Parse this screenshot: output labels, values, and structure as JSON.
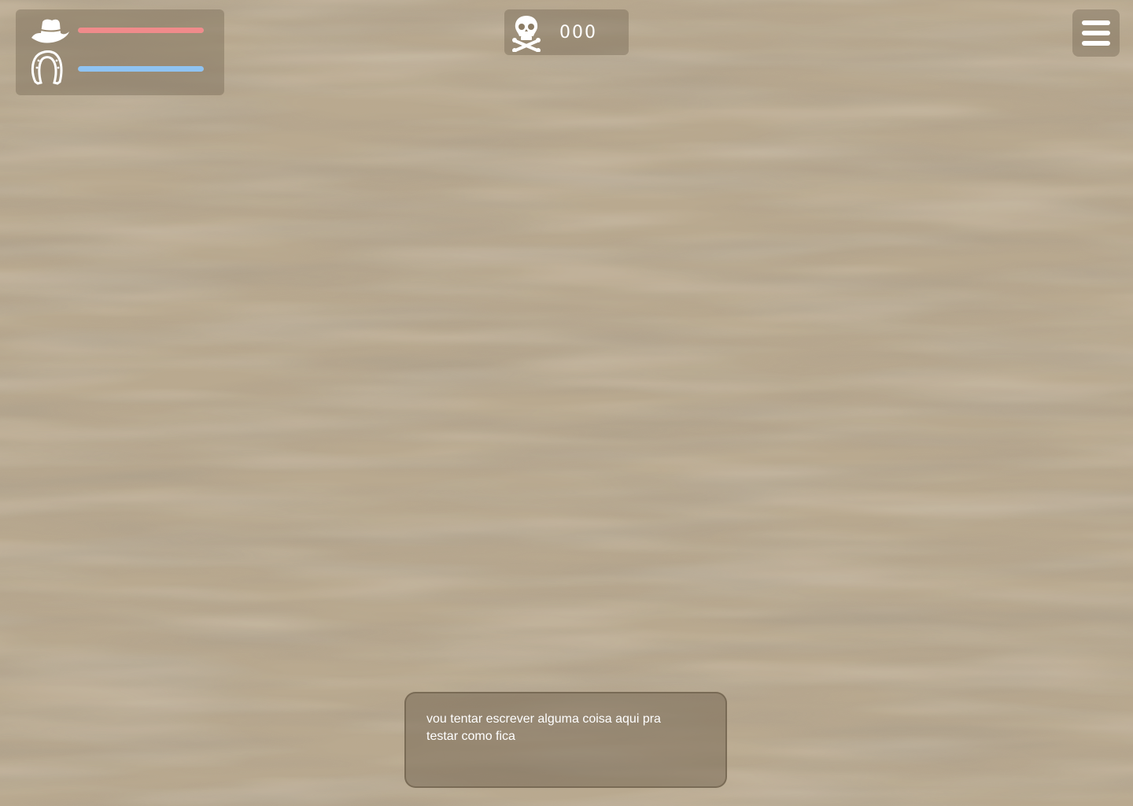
{
  "background": {
    "name": "desert-sand",
    "base_color": "#b9a88d"
  },
  "hud": {
    "health": {
      "icon": "cowboy-hat-icon",
      "value": 1.0,
      "color": "#f08b8b"
    },
    "stamina": {
      "icon": "horseshoe-icon",
      "value": 1.0,
      "color": "#8fc3f2"
    },
    "kills": {
      "icon": "skull-crossbones-icon",
      "count": "000"
    },
    "menu": {
      "icon": "hamburger-menu-icon"
    }
  },
  "dialog": {
    "text": "vou tentar escrever alguma coisa aqui pra testar como fica"
  }
}
